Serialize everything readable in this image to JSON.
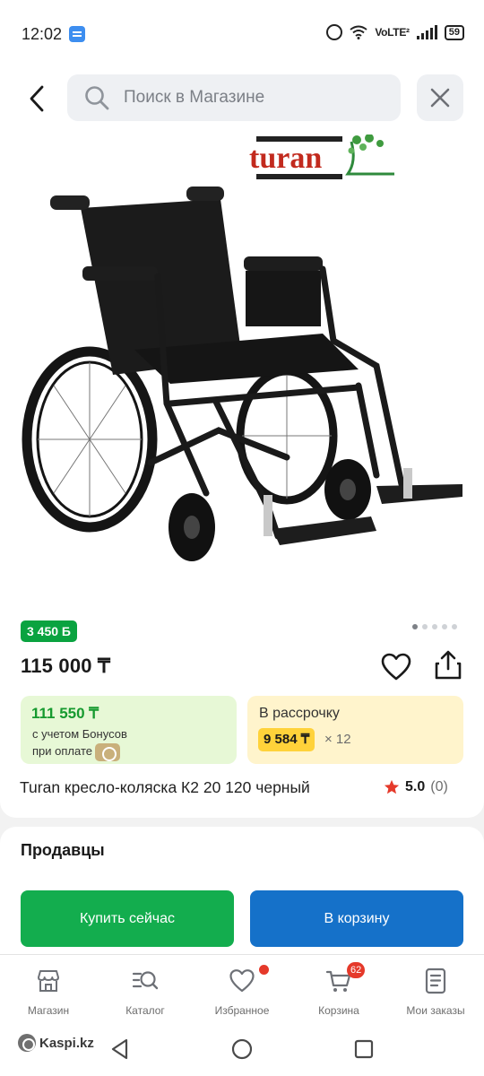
{
  "status_bar": {
    "time": "12:02",
    "network": "VoLTE²",
    "battery": "59"
  },
  "header": {
    "search_placeholder": "Поиск в Магазине"
  },
  "product": {
    "image_logo_text": "turan",
    "bonus_badge": "3 450 Б",
    "price": "115 000 ₸",
    "gallery_dots": 5,
    "gallery_active": 0,
    "payment_price": "111 550 ₸",
    "payment_note_line1": "с учетом Бонусов",
    "payment_note_line2": "при оплате",
    "installment_label": "В рассрочку",
    "installment_price": "9 584 ₸",
    "installment_times": "× 12",
    "title": "Turan кресло-коляска К2 20 120 черный",
    "rating": "5.0",
    "rating_count": "(0)"
  },
  "sellers": {
    "title": "Продавцы",
    "buy_now": "Купить сейчас",
    "add_to_cart": "В корзину"
  },
  "bottom_nav": {
    "items": [
      {
        "label": "Магазин",
        "icon": "shop-icon"
      },
      {
        "label": "Каталог",
        "icon": "catalog-icon"
      },
      {
        "label": "Избранное",
        "icon": "heart-icon"
      },
      {
        "label": "Корзина",
        "icon": "cart-icon",
        "badge": "62"
      },
      {
        "label": "Мои заказы",
        "icon": "orders-icon"
      }
    ]
  },
  "system_nav": {
    "brand": "Kaspi.kz"
  },
  "colors": {
    "green": "#13ad4e",
    "blue": "#1571c9",
    "yellow": "#ffd23a",
    "red": "#e5392a"
  }
}
